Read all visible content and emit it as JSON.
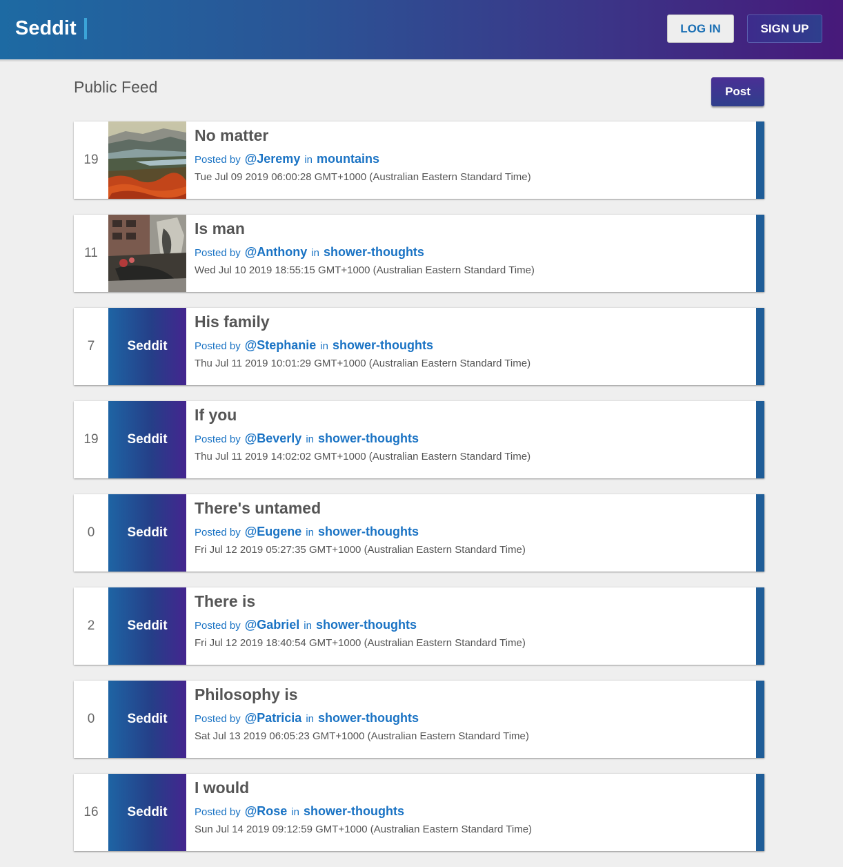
{
  "header": {
    "logo": "Seddit",
    "login_label": "LOG IN",
    "signup_label": "SIGN UP"
  },
  "feed": {
    "title": "Public Feed",
    "post_button": "Post"
  },
  "labels": {
    "posted_by": "Posted by",
    "in": "in",
    "default_thumb": "Seddit"
  },
  "colors": {
    "header_gradient_start": "#1d6aa3",
    "header_gradient_end": "#47197a",
    "link": "#1a73c4",
    "accent_bar": "#1f5d98"
  },
  "posts": [
    {
      "score": "19",
      "title": "No matter",
      "author": "@Jeremy",
      "subseddit": "mountains",
      "date": "Tue Jul 09 2019 06:00:28 GMT+1000 (Australian Eastern Standard Time)",
      "thumbnail": "mountain-landscape-image"
    },
    {
      "score": "11",
      "title": "Is man",
      "author": "@Anthony",
      "subseddit": "shower-thoughts",
      "date": "Wed Jul 10 2019 18:55:15 GMT+1000 (Australian Eastern Standard Time)",
      "thumbnail": "sculpture-photo-image"
    },
    {
      "score": "7",
      "title": "His family",
      "author": "@Stephanie",
      "subseddit": "shower-thoughts",
      "date": "Thu Jul 11 2019 10:01:29 GMT+1000 (Australian Eastern Standard Time)",
      "thumbnail": "default"
    },
    {
      "score": "19",
      "title": "If you",
      "author": "@Beverly",
      "subseddit": "shower-thoughts",
      "date": "Thu Jul 11 2019 14:02:02 GMT+1000 (Australian Eastern Standard Time)",
      "thumbnail": "default"
    },
    {
      "score": "0",
      "title": "There's untamed",
      "author": "@Eugene",
      "subseddit": "shower-thoughts",
      "date": "Fri Jul 12 2019 05:27:35 GMT+1000 (Australian Eastern Standard Time)",
      "thumbnail": "default"
    },
    {
      "score": "2",
      "title": "There is",
      "author": "@Gabriel",
      "subseddit": "shower-thoughts",
      "date": "Fri Jul 12 2019 18:40:54 GMT+1000 (Australian Eastern Standard Time)",
      "thumbnail": "default"
    },
    {
      "score": "0",
      "title": "Philosophy is",
      "author": "@Patricia",
      "subseddit": "shower-thoughts",
      "date": "Sat Jul 13 2019 06:05:23 GMT+1000 (Australian Eastern Standard Time)",
      "thumbnail": "default"
    },
    {
      "score": "16",
      "title": "I would",
      "author": "@Rose",
      "subseddit": "shower-thoughts",
      "date": "Sun Jul 14 2019 09:12:59 GMT+1000 (Australian Eastern Standard Time)",
      "thumbnail": "default"
    }
  ]
}
